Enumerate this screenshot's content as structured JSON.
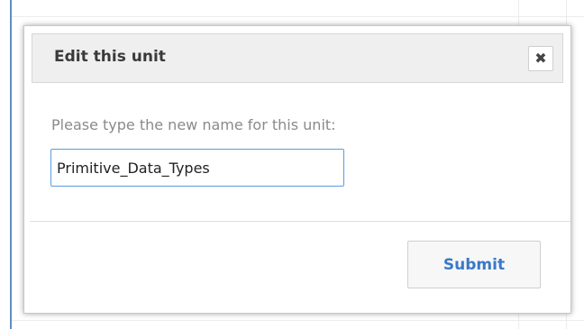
{
  "dialog": {
    "title": "Edit this unit",
    "close_icon": "close-icon",
    "prompt": "Please type the new name for this unit:",
    "input_value": "Primitive_Data_Types",
    "submit_label": "Submit"
  },
  "colors": {
    "accent": "#3a78c8",
    "input_border_focus": "#5b9be0",
    "header_bg": "#efefef"
  }
}
